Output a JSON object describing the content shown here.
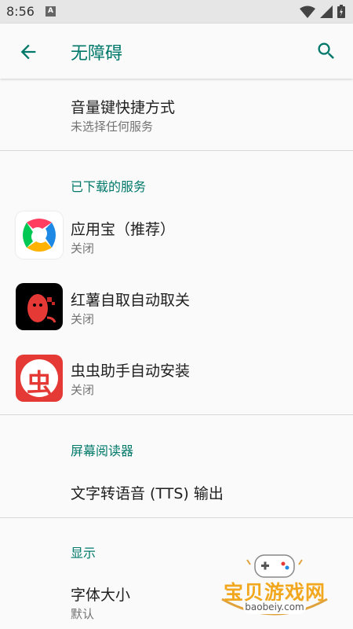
{
  "status_bar": {
    "time": "8:56",
    "notification_glyph": "A",
    "icons": [
      "wifi-icon",
      "signal-icon",
      "battery-icon"
    ]
  },
  "app_bar": {
    "title": "无障碍",
    "back_icon": "arrow-back-icon",
    "search_icon": "search-icon"
  },
  "volume_shortcut": {
    "title": "音量键快捷方式",
    "summary": "未选择任何服务"
  },
  "downloaded_services": {
    "header": "已下载的服务",
    "items": [
      {
        "title": "应用宝（推荐）",
        "summary": "关闭"
      },
      {
        "title": "红薯自取自动取关",
        "summary": "关闭"
      },
      {
        "title": "虫虫助手自动安装",
        "summary": "关闭",
        "icon_glyph": "虫"
      }
    ]
  },
  "screen_reader": {
    "header": "屏幕阅读器",
    "tts": {
      "title": "文字转语音 (TTS) 输出"
    }
  },
  "display": {
    "header": "显示",
    "font_size": {
      "title": "字体大小",
      "summary": "默认"
    }
  },
  "watermark": {
    "title": "宝贝游戏网",
    "url": "baobeiy.com"
  },
  "colors": {
    "accent": "#00796b",
    "app_bar_bg": "#fafafa",
    "status_bar_bg": "#e6e6e6"
  }
}
